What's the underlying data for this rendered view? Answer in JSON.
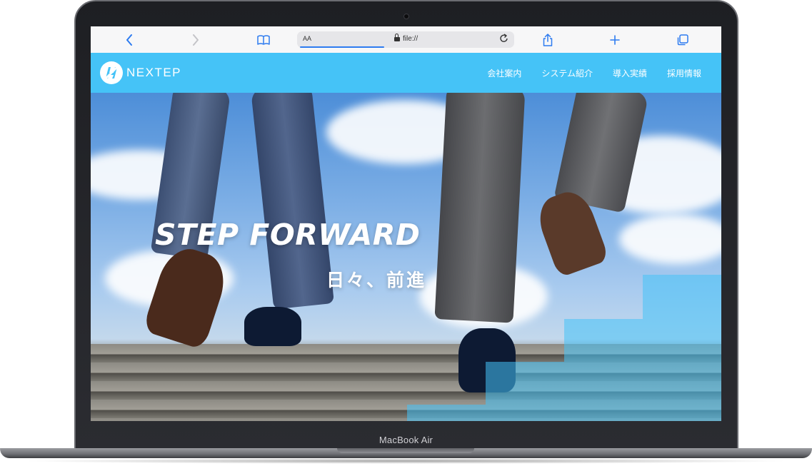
{
  "device": {
    "label": "MacBook Air"
  },
  "browser": {
    "text_size_label": "AA",
    "url": "file://",
    "icons": [
      "back-icon",
      "forward-icon",
      "bookmarks-icon",
      "lock-icon",
      "reload-icon",
      "share-icon",
      "new-tab-icon",
      "tabs-icon"
    ]
  },
  "site": {
    "logo_text": "NEXTEP",
    "nav": [
      {
        "label": "会社案内"
      },
      {
        "label": "システム紹介"
      },
      {
        "label": "導入実績"
      },
      {
        "label": "採用情報"
      }
    ],
    "hero": {
      "title": "STEP FORWARD",
      "subtitle": "日々、前進"
    }
  },
  "colors": {
    "brand": "#45c3f7",
    "safari_blue": "#2d7bf0",
    "laptop_body": "#2b2c31"
  }
}
